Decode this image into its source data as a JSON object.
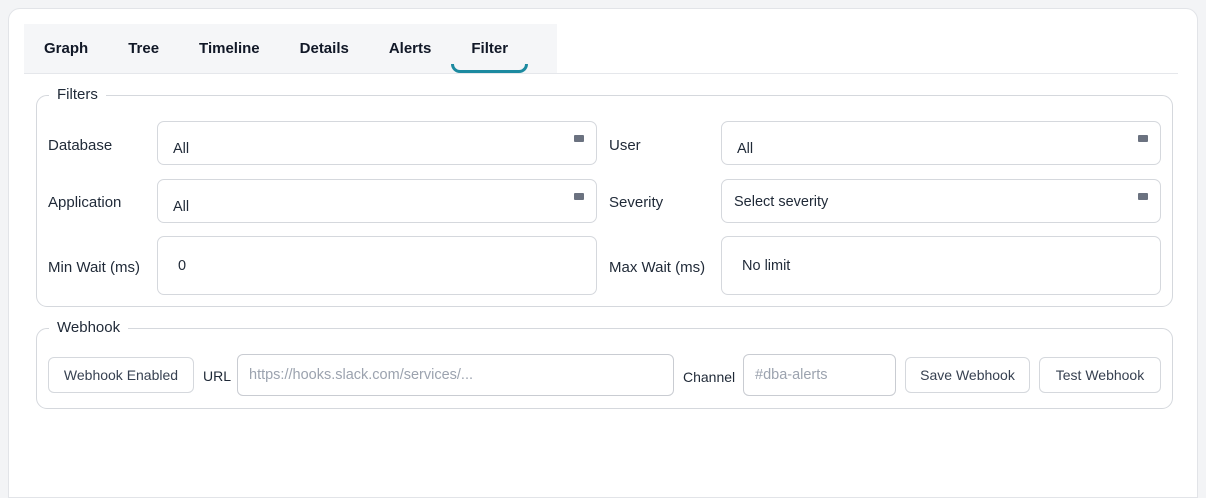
{
  "tabs": [
    {
      "label": "Graph"
    },
    {
      "label": "Tree"
    },
    {
      "label": "Timeline"
    },
    {
      "label": "Details"
    },
    {
      "label": "Alerts"
    },
    {
      "label": "Filter",
      "active": true
    }
  ],
  "filters": {
    "legend": "Filters",
    "database": {
      "label": "Database",
      "value": "All"
    },
    "user": {
      "label": "User",
      "value": "All"
    },
    "application": {
      "label": "Application",
      "value": "All"
    },
    "severity": {
      "label": "Severity",
      "value": "Select severity"
    },
    "min_wait": {
      "label": "Min Wait (ms)",
      "value": "0"
    },
    "max_wait": {
      "label": "Max Wait (ms)",
      "value": "No limit"
    }
  },
  "webhook": {
    "legend": "Webhook",
    "enabled_button": "Webhook Enabled",
    "url_label": "URL",
    "url_placeholder": "https://hooks.slack.com/services/...",
    "channel_label": "Channel",
    "channel_placeholder": "#dba-alerts",
    "save_button": "Save Webhook",
    "test_button": "Test Webhook"
  },
  "colors": {
    "accent": "#1c8aa0",
    "border": "#d5d8dd"
  }
}
